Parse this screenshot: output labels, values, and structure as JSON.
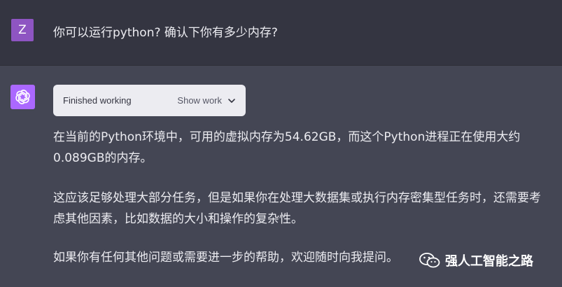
{
  "conversation": {
    "user": {
      "avatar_letter": "Z",
      "message": "你可以运行python? 确认下你有多少内存?"
    },
    "assistant": {
      "tool_status": "Finished working",
      "show_work_label": "Show work",
      "paragraphs": [
        "在当前的Python环境中，可用的虚拟内存为54.62GB，而这个Python进程正在使用大约0.089GB的内存。",
        "这应该足够处理大部分任务，但是如果你在处理大数据集或执行内存密集型任务时，还需要考虑其他因素，比如数据的大小和操作的复杂性。",
        "如果你有任何其他问题或需要进一步的帮助，欢迎随时向我提问。"
      ]
    }
  },
  "watermark": {
    "text": "强人工智能之路",
    "icon": "wechat-icon"
  },
  "colors": {
    "user_bg": "#343541",
    "assistant_bg": "#444654",
    "user_avatar": "#8e55c2",
    "assistant_avatar": "#ab68ff"
  }
}
